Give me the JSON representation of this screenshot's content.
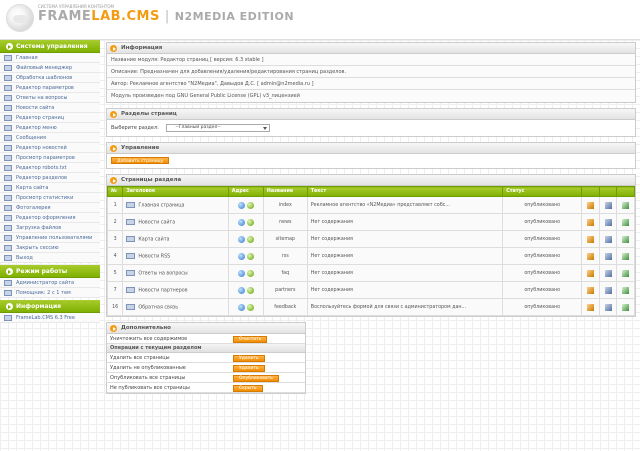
{
  "header": {
    "subtitle": "СИСТЕМА УПРАВЛЕНИЯ КОНТЕНТОМ",
    "brand_frame": "FRAME",
    "brand_lab": "LAB.CMS",
    "brand_sep": "|",
    "brand_edition": "N2MEDIA EDITION"
  },
  "sidebar": {
    "sections": [
      {
        "title": "Система управления",
        "items": [
          "Главная",
          "Файловый менеджер",
          "Обработка шаблонов",
          "Редактор параметров",
          "Ответы на вопросы",
          "Новости сайта",
          "Редактор страниц",
          "Редактор меню",
          "Сообщения",
          "Редактор новостей",
          "Просмотр параметров",
          "Редактор robots.txt",
          "Редактор разделов",
          "Карта сайта",
          "Просмотр статистики",
          "Фотогалерея",
          "Редактор оформления",
          "Загрузка файлов",
          "Управление пользователями",
          "Закрыть сессию",
          "Выход"
        ]
      },
      {
        "title": "Режим работы",
        "items": [
          "Администратор сайта",
          "Помощник: 2 с 1 тем"
        ]
      },
      {
        "title": "Информация",
        "items": [
          "FrameLab.CMS 6.3 Free"
        ]
      }
    ]
  },
  "info_panel": {
    "title": "Информация",
    "rows": [
      "Название модуля: Редактор страниц [ версия: 6.3 stable ]",
      "Описание: Предназначен для добавления/удаления/редактирования страниц разделов.",
      "Автор: Рекламное агентство \"N2Медиа\", Давыдов Д.С. [ admin@n2media.ru ]",
      "Модуль произведен под GNU General Public License (GPL) v3_лицензией"
    ]
  },
  "sections_panel": {
    "title": "Разделы страниц",
    "label": "Выберите раздел:",
    "selected": "--Главный раздел--"
  },
  "management_panel": {
    "title": "Управление",
    "add_button": "Добавить страницу"
  },
  "pages_panel": {
    "title": "Страницы раздела",
    "columns": [
      "№",
      "Заголовок",
      "Адрес",
      "Название",
      "Текст",
      "Статус"
    ],
    "rows": [
      {
        "n": "1",
        "title": "Главная страница",
        "name": "index",
        "text": "Рекламное агентство «N2Медиа» представляет собс...",
        "status": "опубликовано"
      },
      {
        "n": "2",
        "title": "Новости сайта",
        "name": "news",
        "text": "Нет содержания",
        "status": "опубликовано"
      },
      {
        "n": "3",
        "title": "Карта сайта",
        "name": "sitemap",
        "text": "Нет содержания",
        "status": "опубликовано"
      },
      {
        "n": "4",
        "title": "Новости RSS",
        "name": "rss",
        "text": "Нет содержания",
        "status": "опубликовано"
      },
      {
        "n": "5",
        "title": "Ответы на вопросы",
        "name": "faq",
        "text": "Нет содержания",
        "status": "опубликовано"
      },
      {
        "n": "7",
        "title": "Новости партнеров",
        "name": "partners",
        "text": "Нет содержания",
        "status": "опубликовано"
      },
      {
        "n": "16",
        "title": "Обратная связь",
        "name": "feedback",
        "text": "Воспользуйтесь формой для связи с администратором дан...",
        "status": "опубликовано"
      }
    ]
  },
  "extra_panel": {
    "title": "Дополнительно",
    "clear_label": "Уничтожить все содержимое",
    "clear_button": "Очистить",
    "sub_title": "Операции с текущим разделом",
    "ops": [
      {
        "label": "Удалить все страницы",
        "button": "Удалить"
      },
      {
        "label": "Удалить не опубликованные",
        "button": "Удалить"
      },
      {
        "label": "Опубликовать все страницы",
        "button": "Опубликовать"
      },
      {
        "label": "Не публиковать все страницы",
        "button": "Скрыть"
      }
    ]
  },
  "colors": {
    "accent_green": "#7fb000",
    "accent_orange": "#f08d00"
  }
}
